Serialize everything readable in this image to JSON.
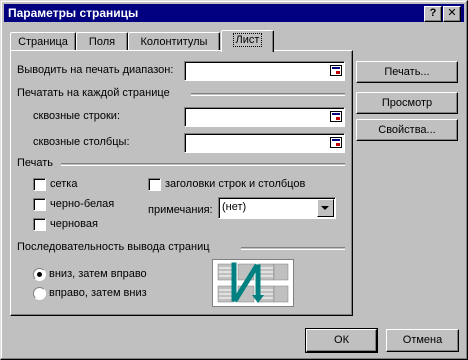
{
  "window": {
    "title": "Параметры страницы",
    "help_label": "?",
    "close_label": "✕"
  },
  "tabs": [
    {
      "label": "Страница",
      "active": false
    },
    {
      "label": "Поля",
      "active": false
    },
    {
      "label": "Колонтитулы",
      "active": false
    },
    {
      "label": "Лист",
      "active": true
    }
  ],
  "print_area": {
    "label": "Выводить на печать диапазон:",
    "value": ""
  },
  "print_titles": {
    "group_label": "Печатать на каждой странице",
    "rows_label": "сквозные строки:",
    "rows_value": "",
    "cols_label": "сквозные столбцы:",
    "cols_value": ""
  },
  "print": {
    "group_label": "Печать",
    "gridlines": {
      "label": "сетка",
      "checked": false
    },
    "black_white": {
      "label": "черно-белая",
      "checked": false
    },
    "draft": {
      "label": "черновая",
      "checked": false
    },
    "headings": {
      "label": "заголовки строк и столбцов",
      "checked": false
    },
    "comments_label": "примечания:",
    "comments_value": "(нет)"
  },
  "page_order": {
    "group_label": "Последовательность вывода страниц",
    "down_then_over": {
      "label": "вниз, затем вправо",
      "selected": true
    },
    "over_then_down": {
      "label": "вправо, затем вниз",
      "selected": false
    }
  },
  "side_buttons": {
    "print": "Печать...",
    "preview": "Просмотр",
    "options": "Свойства..."
  },
  "footer": {
    "ok": "ОК",
    "cancel": "Отмена"
  },
  "colors": {
    "titlebar": "#000080",
    "arrow": "#008080",
    "face": "#c0c0c0"
  }
}
